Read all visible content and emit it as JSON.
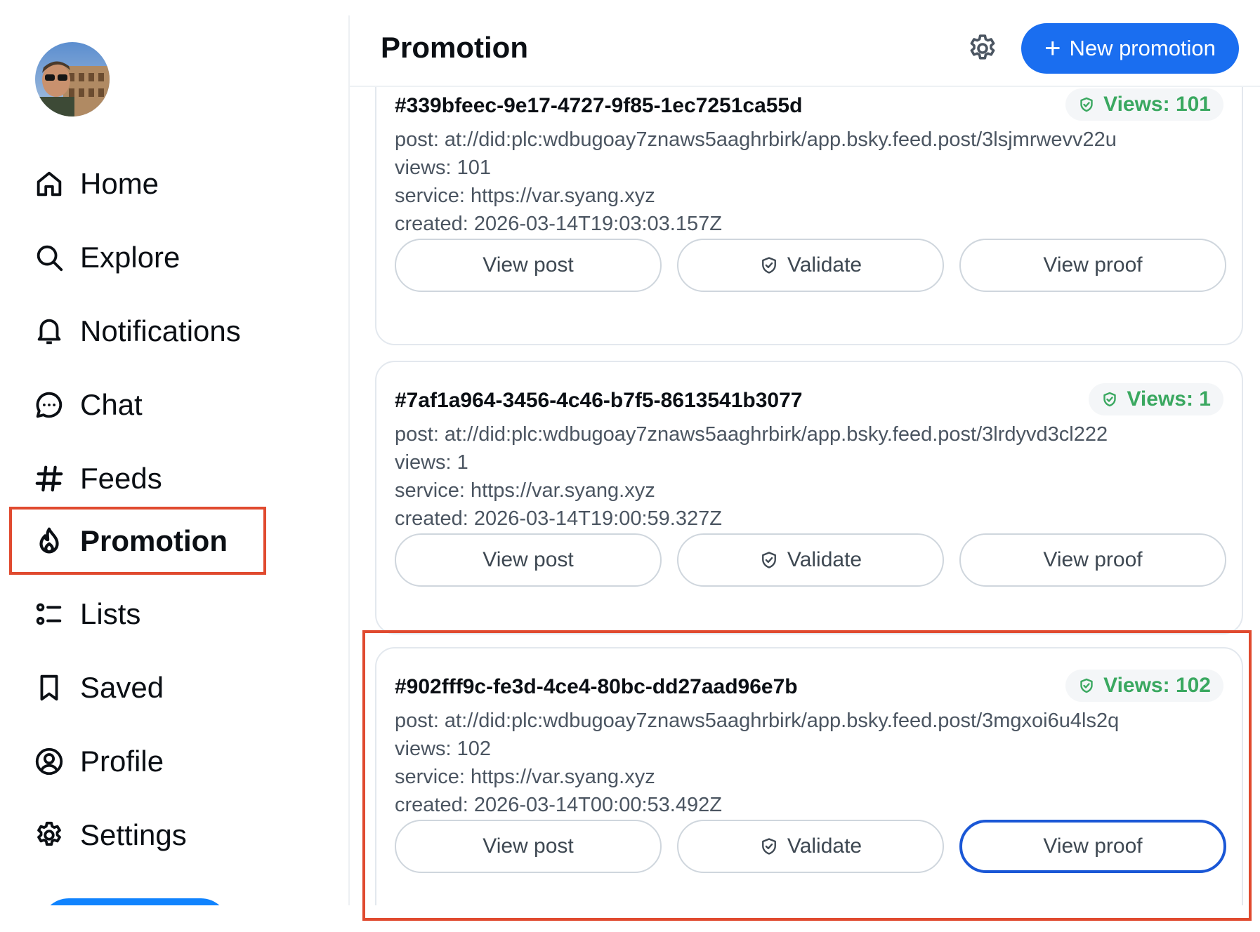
{
  "sidebar": {
    "nav": [
      {
        "label": "Home",
        "icon": "home-icon"
      },
      {
        "label": "Explore",
        "icon": "search-icon"
      },
      {
        "label": "Notifications",
        "icon": "bell-icon"
      },
      {
        "label": "Chat",
        "icon": "chat-bubble-icon"
      },
      {
        "label": "Feeds",
        "icon": "hashtag-icon"
      },
      {
        "label": "Promotion",
        "icon": "flame-icon",
        "active": true
      },
      {
        "label": "Lists",
        "icon": "list-icon"
      },
      {
        "label": "Saved",
        "icon": "bookmark-icon"
      },
      {
        "label": "Profile",
        "icon": "user-circle-icon"
      },
      {
        "label": "Settings",
        "icon": "gear-icon"
      }
    ]
  },
  "header": {
    "title": "Promotion",
    "new_button": "New promotion"
  },
  "cards": [
    {
      "id": "#339bfeec-9e17-4727-9f85-1ec7251ca55d",
      "badge": "Views: 101",
      "post": "post: at://did:plc:wdbugoay7znaws5aaghrbirk/app.bsky.feed.post/3lsjmrwevv22u",
      "views": "views: 101",
      "service": "service: https://var.syang.xyz",
      "created": "created: 2026-03-14T19:03:03.157Z",
      "actions": {
        "view_post": "View post",
        "validate": "Validate",
        "view_proof": "View proof"
      }
    },
    {
      "id": "#7af1a964-3456-4c46-b7f5-8613541b3077",
      "badge": "Views: 1",
      "post": "post: at://did:plc:wdbugoay7znaws5aaghrbirk/app.bsky.feed.post/3lrdyvd3cl222",
      "views": "views: 1",
      "service": "service: https://var.syang.xyz",
      "created": "created: 2026-03-14T19:00:59.327Z",
      "actions": {
        "view_post": "View post",
        "validate": "Validate",
        "view_proof": "View proof"
      }
    },
    {
      "id": "#902fff9c-fe3d-4ce4-80bc-dd27aad96e7b",
      "badge": "Views: 102",
      "post": "post: at://did:plc:wdbugoay7znaws5aaghrbirk/app.bsky.feed.post/3mgxoi6u4ls2q",
      "views": "views: 102",
      "service": "service: https://var.syang.xyz",
      "created": "created: 2026-03-14T00:00:53.492Z",
      "actions": {
        "view_post": "View post",
        "validate": "Validate",
        "view_proof": "View proof"
      }
    }
  ],
  "colors": {
    "accent": "#1a6ef0",
    "views_green": "#3aa860",
    "highlight": "#e04a2f"
  }
}
